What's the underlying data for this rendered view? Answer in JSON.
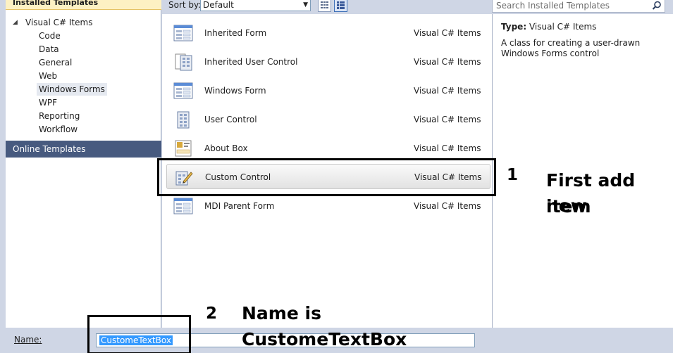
{
  "left_panel": {
    "installed_header": "Installed Templates",
    "tree_root": "Visual C# Items",
    "items": [
      "Code",
      "Data",
      "General",
      "Web",
      "Windows Forms",
      "WPF",
      "Reporting",
      "Workflow"
    ],
    "selected_item": "Windows Forms",
    "online_templates": "Online Templates"
  },
  "toolbar": {
    "sort_label": "Sort by:",
    "sort_value": "Default"
  },
  "search": {
    "placeholder": "Search Installed Templates"
  },
  "templates": [
    {
      "name": "Inherited Form",
      "category": "Visual C# Items",
      "icon": "form-icon"
    },
    {
      "name": "Inherited User Control",
      "category": "Visual C# Items",
      "icon": "user-control-icon"
    },
    {
      "name": "Windows Form",
      "category": "Visual C# Items",
      "icon": "form-icon"
    },
    {
      "name": "User Control",
      "category": "Visual C# Items",
      "icon": "user-control-icon"
    },
    {
      "name": "About Box",
      "category": "Visual C# Items",
      "icon": "about-box-icon"
    },
    {
      "name": "Custom Control",
      "category": "Visual C# Items",
      "icon": "custom-control-icon",
      "selected": true
    },
    {
      "name": "MDI Parent Form",
      "category": "Visual C# Items",
      "icon": "form-icon"
    }
  ],
  "details": {
    "type_label": "Type:",
    "type_value": "Visual C# Items",
    "description": "A class for creating a user-drawn Windows Forms control"
  },
  "name_row": {
    "label": "Name:",
    "value": "CustomeTextBox"
  },
  "annotations": {
    "step1_number": "1",
    "step1_line1": "First add new",
    "step1_line2": "item",
    "step2_number": "2",
    "step2_line1": "Name is",
    "step2_line2": "CustomeTextBox"
  },
  "colors": {
    "panel_background": "#cfd6e5",
    "online_templates_bg": "#475a7f",
    "selection_highlight": "#3399ff",
    "installed_header_bg": "#fdf1c3"
  }
}
